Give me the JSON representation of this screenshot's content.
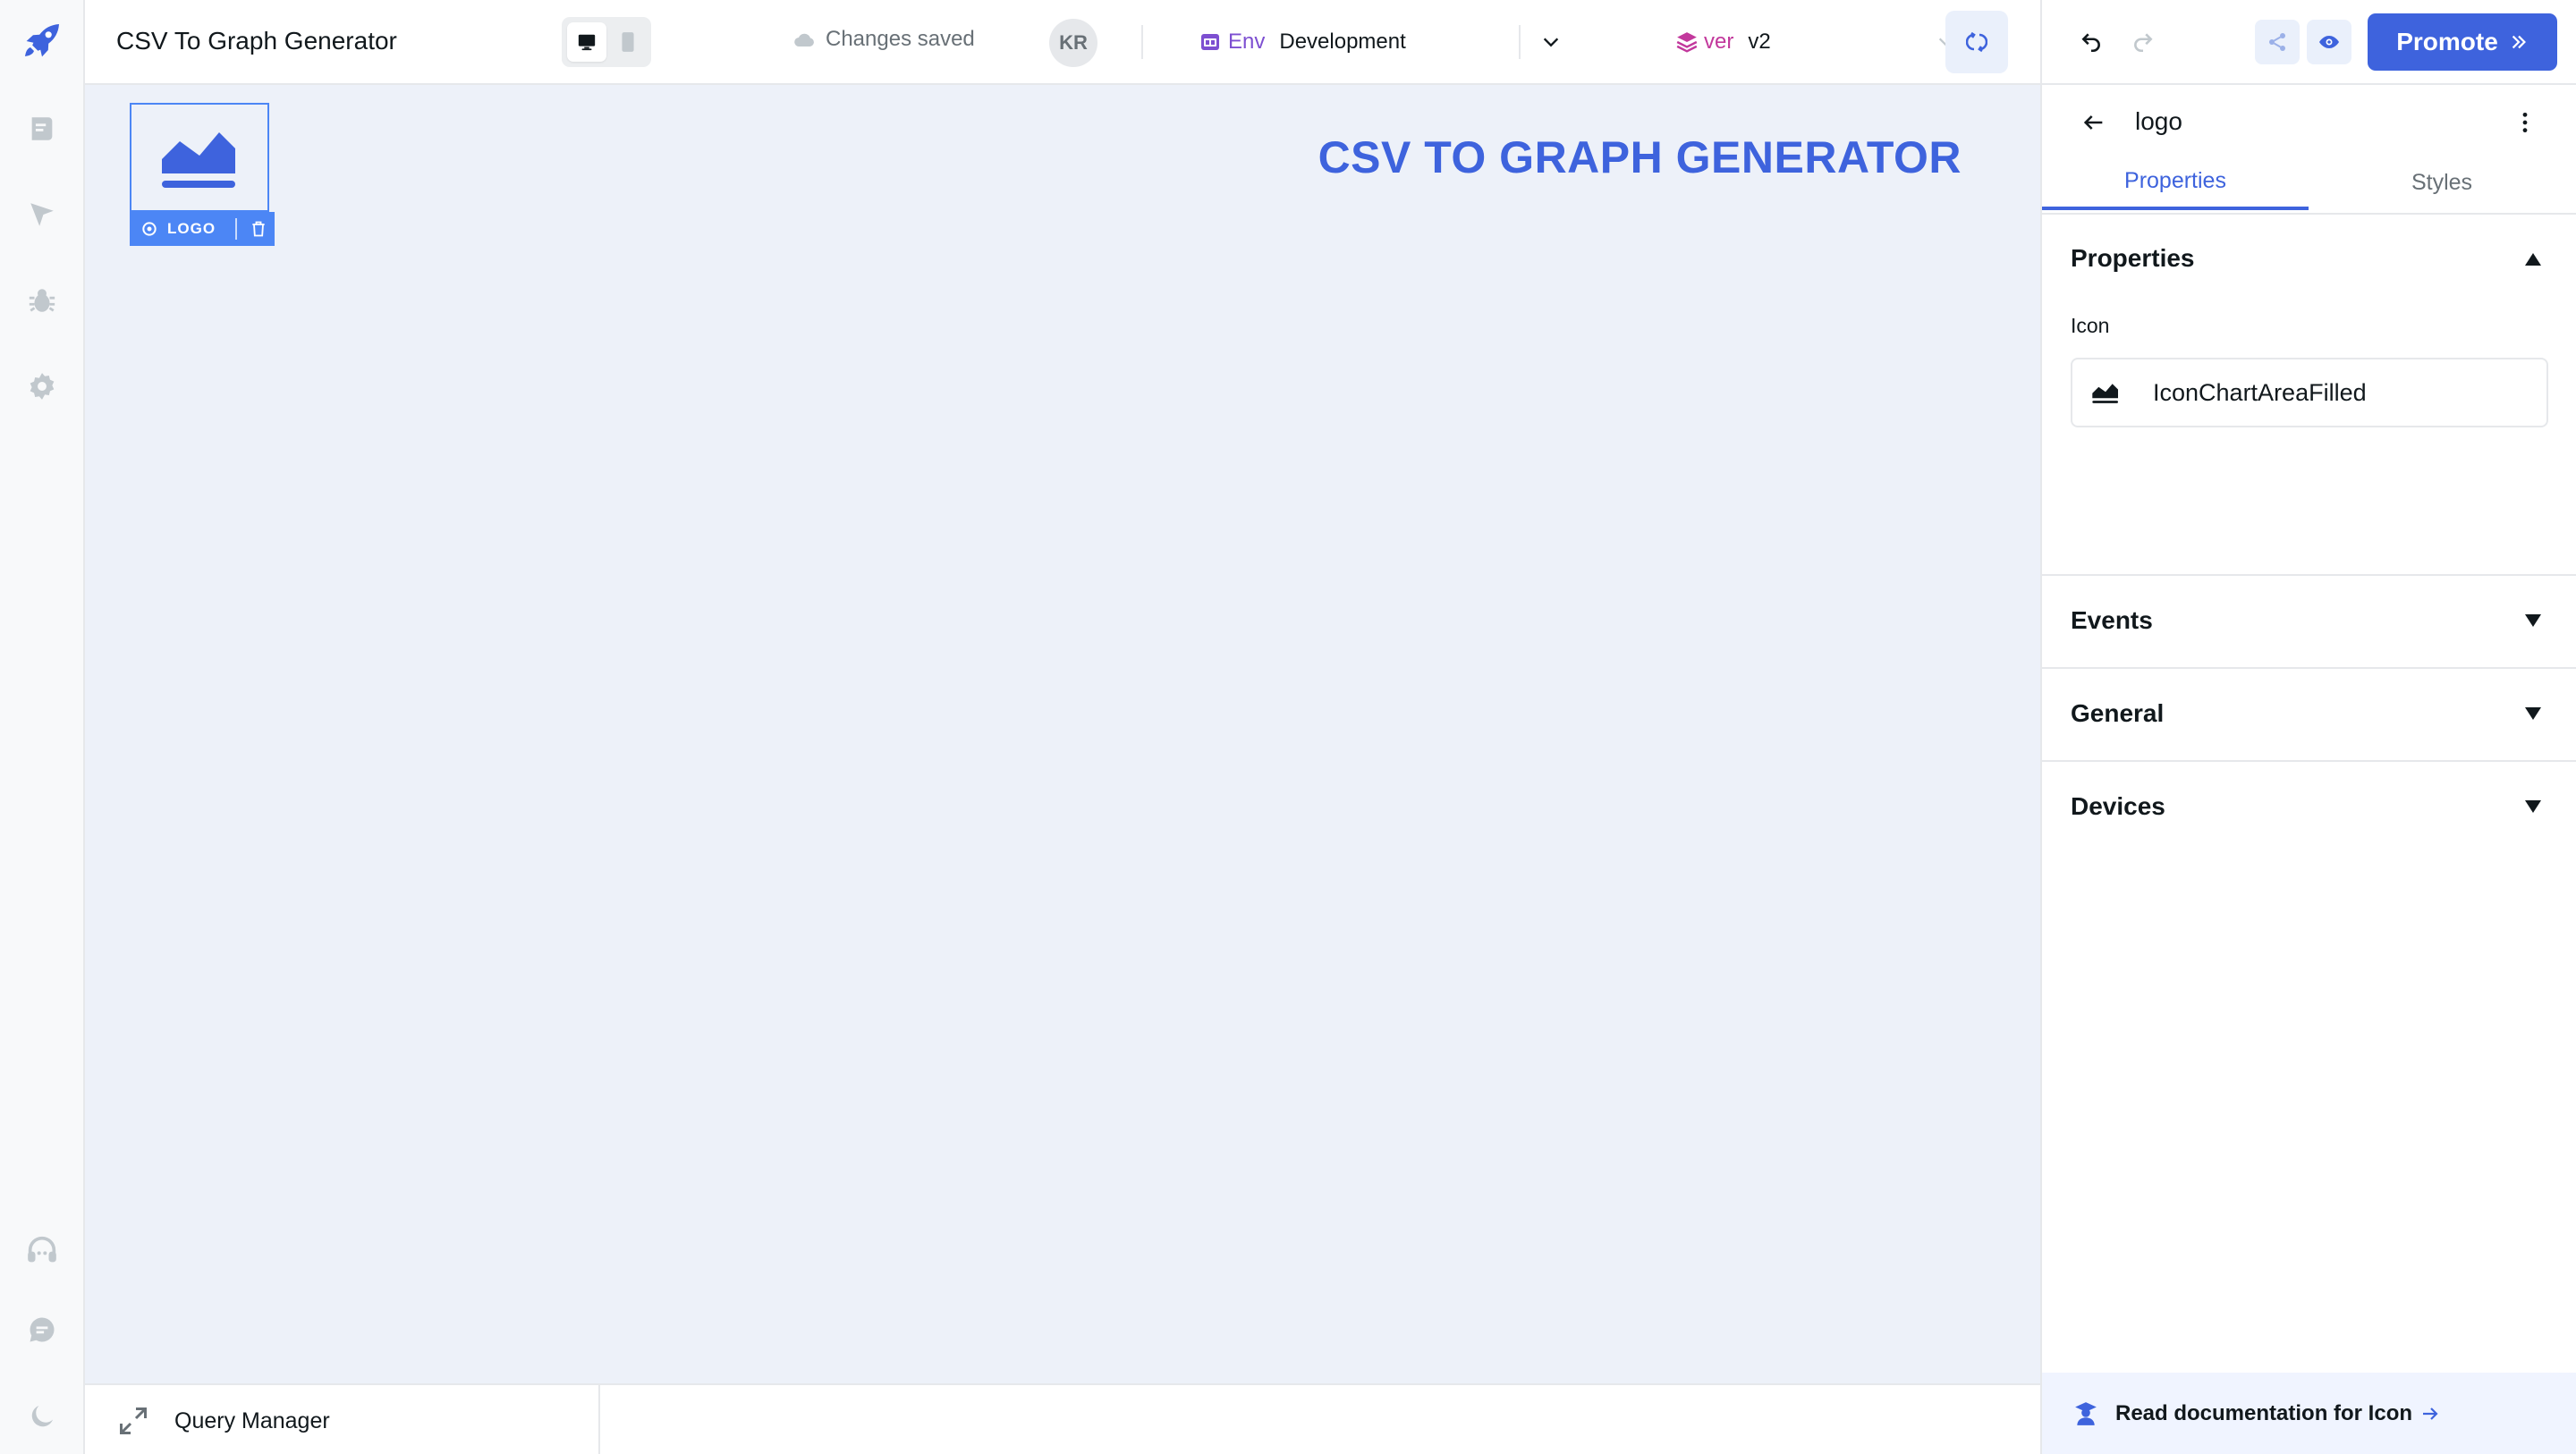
{
  "app": {
    "title": "CSV To Graph Generator",
    "save_status": "Changes saved",
    "user_initials": "KR"
  },
  "environment": {
    "label": "Env",
    "value": "Development"
  },
  "version": {
    "label": "ver",
    "value": "v2"
  },
  "header_actions": {
    "promote_label": "Promote"
  },
  "canvas": {
    "heading": "CSV TO GRAPH GENERATOR",
    "selected_widget": {
      "badge_label": "LOGO",
      "icon": "chart-area-filled-icon"
    }
  },
  "query_manager": {
    "label": "Query Manager"
  },
  "inspector": {
    "component_name": "logo",
    "tabs": [
      {
        "label": "Properties",
        "active": true
      },
      {
        "label": "Styles",
        "active": false
      }
    ],
    "sections": [
      {
        "title": "Properties",
        "expanded": true
      },
      {
        "title": "Events",
        "expanded": false
      },
      {
        "title": "General",
        "expanded": false
      },
      {
        "title": "Devices",
        "expanded": false
      }
    ],
    "icon_field": {
      "label": "Icon",
      "value": "IconChartAreaFilled"
    },
    "docs_link": "Read documentation for Icon"
  },
  "colors": {
    "accent": "#3e63dd",
    "selection": "#4c86f5",
    "canvas_bg": "#edf1f9",
    "env_purple": "#7d4fd1",
    "ver_magenta": "#c2389c",
    "rail_icon": "#c1c8cd"
  },
  "icons": {
    "left_rail": [
      "rocket-logo-icon",
      "pages-icon",
      "inspector-icon",
      "debugger-bug-icon",
      "settings-gear-icon",
      "support-headset-icon",
      "comments-icon",
      "dark-mode-moon-icon"
    ],
    "header": [
      "desktop-icon",
      "mobile-icon",
      "cloud-icon",
      "env-badge-icon",
      "version-layers-icon",
      "chevron-down-icon",
      "refresh-icon",
      "undo-icon",
      "redo-icon",
      "share-icon",
      "preview-eye-icon",
      "chevrons-right-icon"
    ]
  }
}
